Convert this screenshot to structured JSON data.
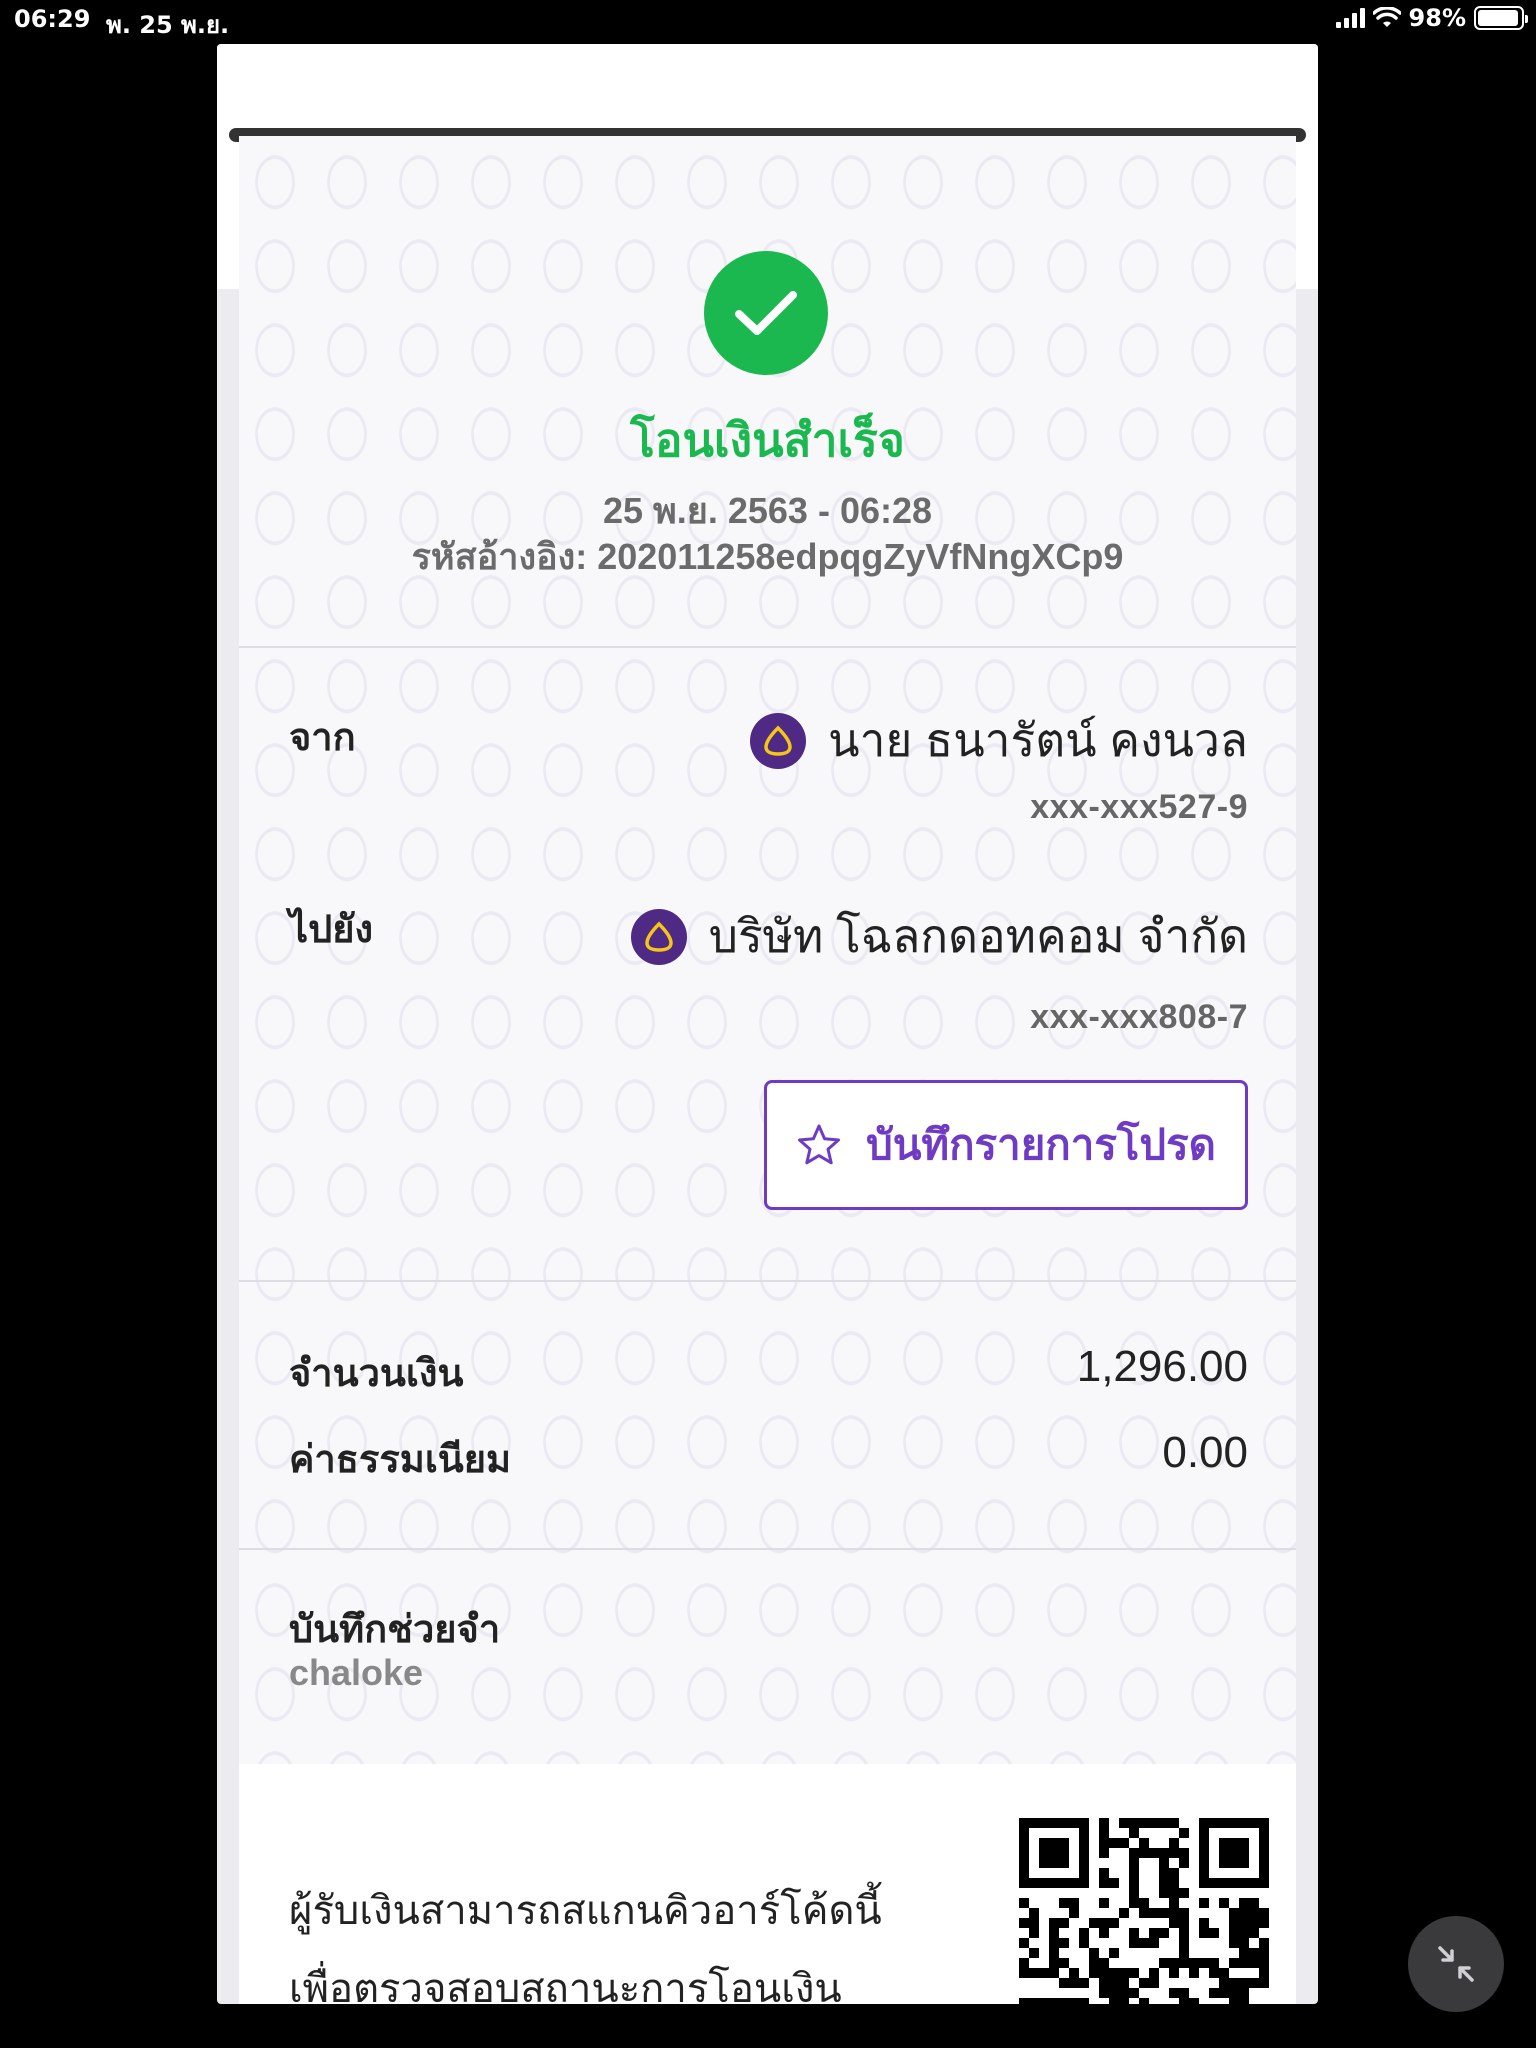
{
  "status_bar": {
    "time": "06:29",
    "date": "พ. 25 พ.ย.",
    "battery": "98%"
  },
  "receipt": {
    "status_title": "โอนเงินสำเร็จ",
    "datetime": "25 พ.ย. 2563 - 06:28",
    "reference": "รหัสอ้างอิง: 202011258edpqgZyVfNngXCp9",
    "from": {
      "label": "จาก",
      "name": "นาย ธนารัตน์ คงนวล",
      "account": "xxx-xxx527-9"
    },
    "to": {
      "label": "ไปยัง",
      "name": "บริษัท โฉลกดอทคอม จำกัด",
      "account": "xxx-xxx808-7"
    },
    "favorite_button": "บันทึกรายการโปรด",
    "amount": {
      "label": "จำนวนเงิน",
      "value": "1,296.00"
    },
    "fee": {
      "label": "ค่าธรรมเนียม",
      "value": "0.00"
    },
    "memo": {
      "label": "บันทึกช่วยจำ",
      "value": "chaloke"
    },
    "qr_info": {
      "line1": "ผู้รับเงินสามารถสแกนคิวอาร์โค้ดนี้",
      "line2": "เพื่อตรวจสอบสถานะการโอนเงิน"
    }
  },
  "colors": {
    "success": "#1bb850",
    "accent": "#6f3bc4",
    "bank": "#4e2a84",
    "bank_logo_gold": "#f5c518"
  },
  "icons": {
    "success": "check-circle-icon",
    "bank": "scb-logo-icon",
    "favorite": "star-outline-icon",
    "minimize": "collapse-arrows-icon"
  }
}
